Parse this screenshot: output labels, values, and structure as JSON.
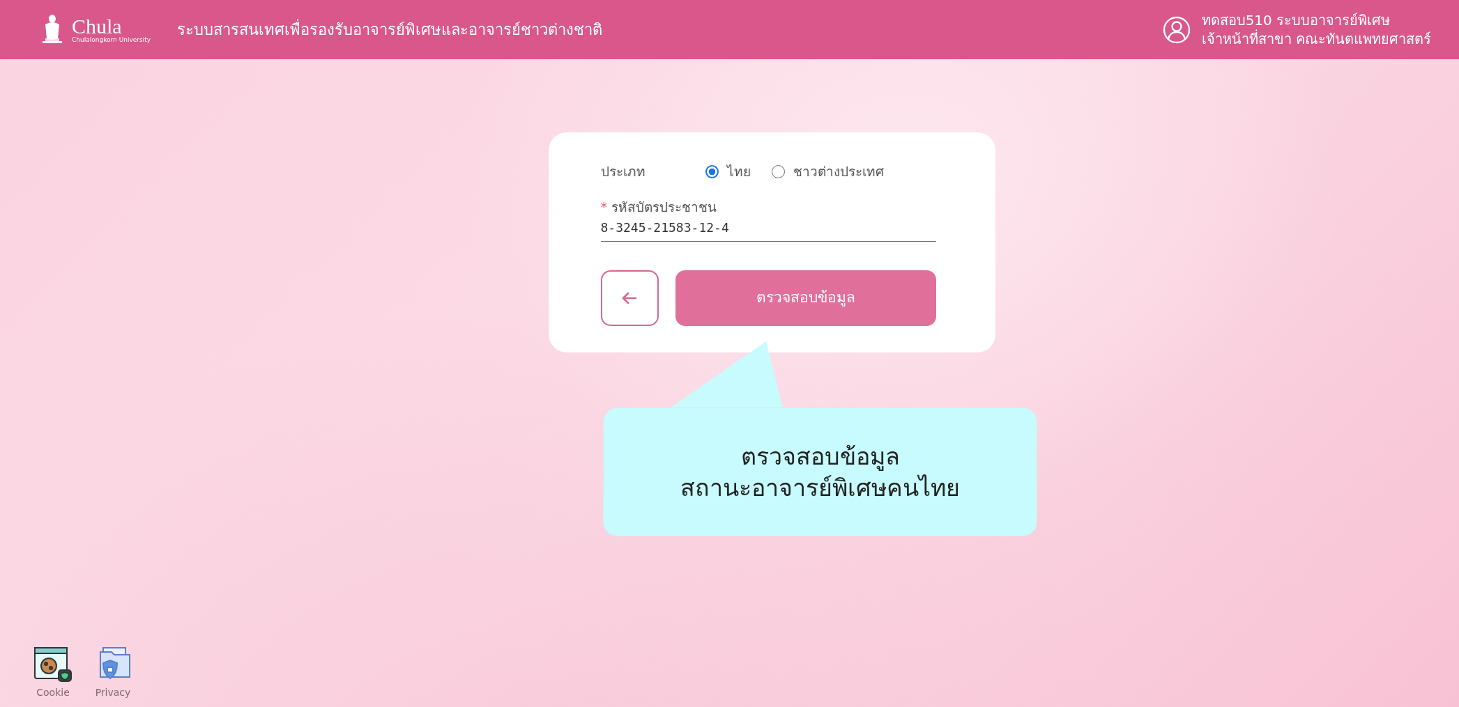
{
  "header": {
    "logo": {
      "wordmark": "Chula",
      "subtitle": "Chulalongkorn University"
    },
    "title": "ระบบสารสนเทศเพื่อรองรับอาจารย์พิเศษและอาจารย์ชาวต่างชาติ",
    "user": {
      "name": "ทดสอบ510 ระบบอาจารย์พิเศษ",
      "role": "เจ้าหน้าที่สาขา คณะทันตแพทยศาสตร์"
    }
  },
  "form": {
    "type_label": "ประเภท",
    "options": [
      {
        "label": "ไทย",
        "selected": true
      },
      {
        "label": "ชาวต่างประเทศ",
        "selected": false
      }
    ],
    "id_field": {
      "required_mark": "*",
      "label": "รหัสบัตรประชาชน",
      "value": "8-3245-21583-12-4"
    },
    "submit_button": "ตรวจสอบข้อมูล"
  },
  "callout": {
    "lines": [
      "ตรวจสอบข้อมูล",
      "สถานะอาจารย์พิเศษคนไทย"
    ]
  },
  "footer_links": [
    {
      "kind": "cookie",
      "label": "Cookie"
    },
    {
      "kind": "privacy",
      "label": "Privacy"
    }
  ]
}
